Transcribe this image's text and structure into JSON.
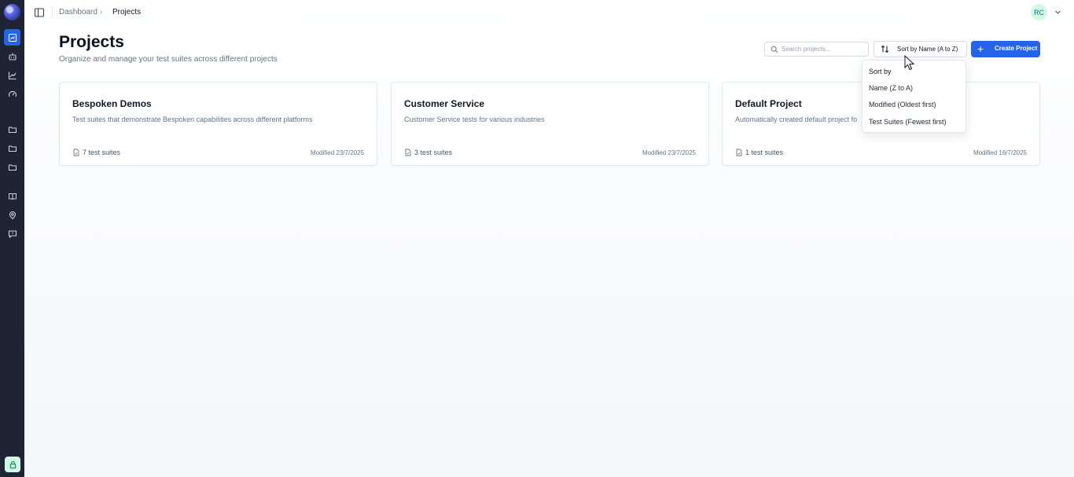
{
  "breadcrumb": {
    "home": "Dashboard",
    "separator": "›",
    "current": "Projects"
  },
  "user": {
    "initials": "RC"
  },
  "page": {
    "title": "Projects",
    "subtitle": "Organize and manage your test suites across different projects"
  },
  "search": {
    "placeholder": "Search projects...",
    "value": ""
  },
  "sort": {
    "label": "Sort by Name (A to Z)",
    "menu_heading": "Sort by",
    "options": [
      "Name (Z to A)",
      "Modified (Oldest first)",
      "Test Suites (Fewest first)"
    ]
  },
  "create_button": {
    "plus": "+",
    "label": "Create Project"
  },
  "projects": [
    {
      "title": "Bespoken Demos",
      "description": "Test suites that demonstrate Bespoken capabilities across different platforms",
      "suites": "7 test suites",
      "modified": "Modified 23/7/2025"
    },
    {
      "title": "Customer Service",
      "description": "Customer Service tests for various industries",
      "suites": "3 test suites",
      "modified": "Modified 23/7/2025"
    },
    {
      "title": "Default Project",
      "description": "Automatically created default project fo",
      "suites": "1 test suites",
      "modified": "Modified 16/7/2025"
    }
  ],
  "colors": {
    "accent": "#2563eb",
    "sidebar": "#1e2433"
  }
}
